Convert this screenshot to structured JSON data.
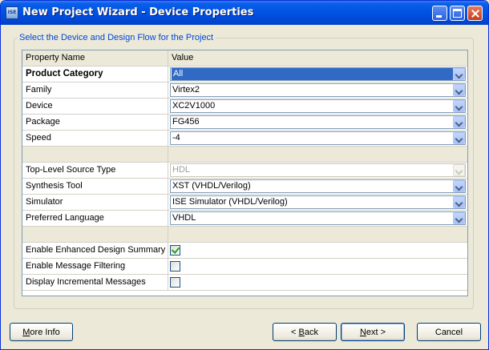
{
  "window": {
    "title": "New Project Wizard - Device Properties",
    "app_icon_text": "ISE"
  },
  "group": {
    "legend": "Select the Device and Design Flow for the Project"
  },
  "grid": {
    "header": {
      "name": "Property Name",
      "value": "Value"
    },
    "rows": [
      {
        "name": "Product Category",
        "type": "combo",
        "value": "All",
        "bold": true,
        "selected": true
      },
      {
        "name": "Family",
        "type": "combo",
        "value": "Virtex2"
      },
      {
        "name": "Device",
        "type": "combo",
        "value": "XC2V1000"
      },
      {
        "name": "Package",
        "type": "combo",
        "value": "FG456"
      },
      {
        "name": "Speed",
        "type": "combo",
        "value": "-4"
      },
      {
        "type": "sep"
      },
      {
        "name": "Top-Level Source Type",
        "type": "combo",
        "value": "HDL",
        "disabled": true
      },
      {
        "name": "Synthesis Tool",
        "type": "combo",
        "value": "XST (VHDL/Verilog)"
      },
      {
        "name": "Simulator",
        "type": "combo",
        "value": "ISE Simulator (VHDL/Verilog)"
      },
      {
        "name": "Preferred Language",
        "type": "combo",
        "value": "VHDL"
      },
      {
        "type": "sep"
      },
      {
        "name": "Enable Enhanced Design Summary",
        "type": "check",
        "checked": true
      },
      {
        "name": "Enable Message Filtering",
        "type": "check",
        "checked": false
      },
      {
        "name": "Display Incremental Messages",
        "type": "check",
        "checked": false
      }
    ]
  },
  "buttons": {
    "more_info": {
      "mnemonic": "M",
      "rest": "ore Info"
    },
    "back": {
      "prefix": "< ",
      "mnemonic": "B",
      "rest": "ack"
    },
    "next": {
      "mnemonic": "N",
      "rest": "ext >"
    },
    "cancel": {
      "label": "Cancel"
    }
  }
}
